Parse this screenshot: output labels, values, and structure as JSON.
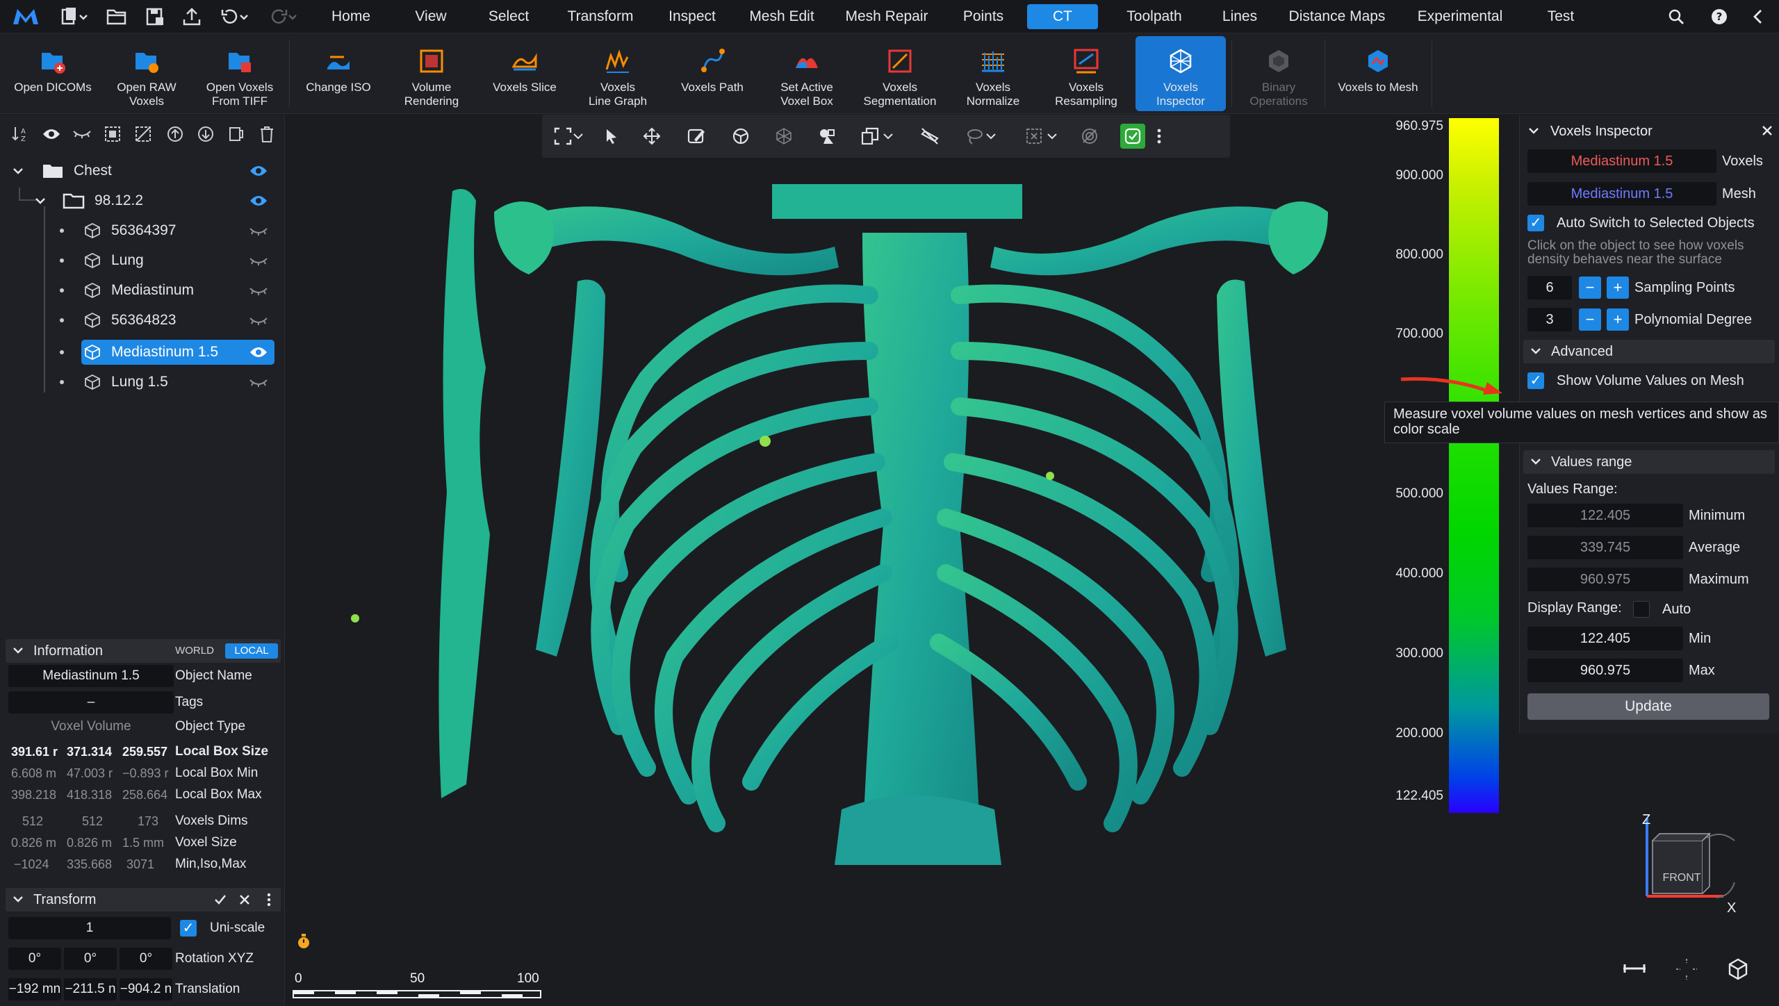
{
  "menu": {
    "tabs": [
      "Home",
      "View",
      "Select",
      "Transform",
      "Inspect",
      "Mesh Edit",
      "Mesh Repair",
      "Points",
      "CT",
      "Toolpath",
      "Lines",
      "Distance Maps",
      "Experimental",
      "Test"
    ],
    "active": "CT"
  },
  "ribbon": {
    "buttons": [
      {
        "label": "Open DICOMs",
        "icon": "open-dicoms-icon"
      },
      {
        "label": "Open RAW\nVoxels",
        "icon": "open-raw-voxels-icon"
      },
      {
        "label": "Open Voxels\nFrom TIFF",
        "icon": "open-tiff-icon"
      },
      {
        "label": "Change ISO",
        "icon": "change-iso-icon"
      },
      {
        "label": "Volume\nRendering",
        "icon": "volume-rendering-icon"
      },
      {
        "label": "Voxels Slice",
        "icon": "voxels-slice-icon"
      },
      {
        "label": "Voxels\nLine Graph",
        "icon": "line-graph-icon"
      },
      {
        "label": "Voxels Path",
        "icon": "voxels-path-icon"
      },
      {
        "label": "Set Active\nVoxel Box",
        "icon": "voxel-box-icon"
      },
      {
        "label": "Voxels\nSegmentation",
        "icon": "segmentation-icon"
      },
      {
        "label": "Voxels\nNormalize",
        "icon": "normalize-icon"
      },
      {
        "label": "Voxels\nResampling",
        "icon": "resampling-icon"
      },
      {
        "label": "Voxels\nInspector",
        "icon": "inspector-icon"
      },
      {
        "label": "Binary\nOperations",
        "icon": "binary-operations-icon"
      },
      {
        "label": "Voxels to Mesh",
        "icon": "voxels-to-mesh-icon"
      }
    ]
  },
  "scene_tree": {
    "root": "Chest",
    "group": "98.12.2",
    "items": [
      "56364397",
      "Lung",
      "Mediastinum",
      "56364823",
      "Mediastinum 1.5",
      "Lung 1.5"
    ],
    "selected": "Mediastinum 1.5"
  },
  "information": {
    "title": "Information",
    "mode_world": "WORLD",
    "mode_local": "LOCAL",
    "object_name_value": "Mediastinum 1.5",
    "object_name_label": "Object Name",
    "tags_value": "–",
    "tags_label": "Tags",
    "object_type_value": "Voxel Volume",
    "object_type_label": "Object Type",
    "rows": [
      {
        "label": "Local Box Size",
        "values": [
          "391.61 r",
          "371.314",
          "259.557"
        ],
        "bold": true
      },
      {
        "label": "Local Box Min",
        "values": [
          "6.608 m",
          "47.003 r",
          "−0.893 r"
        ],
        "bold": false
      },
      {
        "label": "Local Box Max",
        "values": [
          "398.218",
          "418.318",
          "258.664"
        ],
        "bold": false
      },
      {
        "label": "Voxels Dims",
        "values": [
          "512",
          "512",
          "173"
        ],
        "bold": false
      },
      {
        "label": "Voxel Size",
        "values": [
          "0.826 m",
          "0.826 m",
          "1.5 mm"
        ],
        "bold": false
      },
      {
        "label": "Min,Iso,Max",
        "values": [
          "−1024",
          "335.668",
          "3071"
        ],
        "bold": false
      }
    ]
  },
  "transform": {
    "title": "Transform",
    "scale_value": "1",
    "uniscale_label": "Uni-scale",
    "rotation": [
      "0°",
      "0°",
      "0°"
    ],
    "rotation_label": "Rotation XYZ",
    "translation": [
      "−192 mn",
      "−211.5 n",
      "−904.2 n"
    ],
    "translation_label": "Translation"
  },
  "colorbar": {
    "ticks": [
      "960.975",
      "900.000",
      "800.000",
      "700.000",
      "500.000",
      "400.000",
      "300.000",
      "200.000",
      "122.405"
    ],
    "colors": [
      "#ffff00",
      "#22e000",
      "#00c82a",
      "#2a00ff"
    ]
  },
  "inspector": {
    "title": "Voxels Inspector",
    "voxels_value": "Mediastinum 1.5",
    "voxels_label": "Voxels",
    "mesh_value": "Mediastinum 1.5",
    "mesh_label": "Mesh",
    "auto_switch_label": "Auto Switch to Selected Objects",
    "hint": "Click on the object to see how voxels density behaves near the surface",
    "sampling_value": "6",
    "sampling_label": "Sampling Points",
    "poly_value": "3",
    "poly_label": "Polynomial Degree",
    "advanced_label": "Advanced",
    "show_values_label": "Show Volume Values on Mesh",
    "tooltip": "Measure voxel volume values on mesh vertices and show as color scale",
    "values_range_head": "Values range",
    "values_range_caption": "Values Range:",
    "minimum_value": "122.405",
    "minimum_label": "Minimum",
    "average_value": "339.745",
    "average_label": "Average",
    "maximum_value": "960.975",
    "maximum_label": "Maximum",
    "display_range_caption": "Display Range:",
    "auto_label": "Auto",
    "min_value": "122.405",
    "min_label": "Min",
    "max_value": "960.975",
    "max_label": "Max",
    "update_label": "Update"
  },
  "view_cube": {
    "face": "FRONT",
    "axis_z": "Z",
    "axis_x": "X"
  },
  "scale_bar": {
    "ticks": [
      "0",
      "50",
      "100"
    ]
  }
}
